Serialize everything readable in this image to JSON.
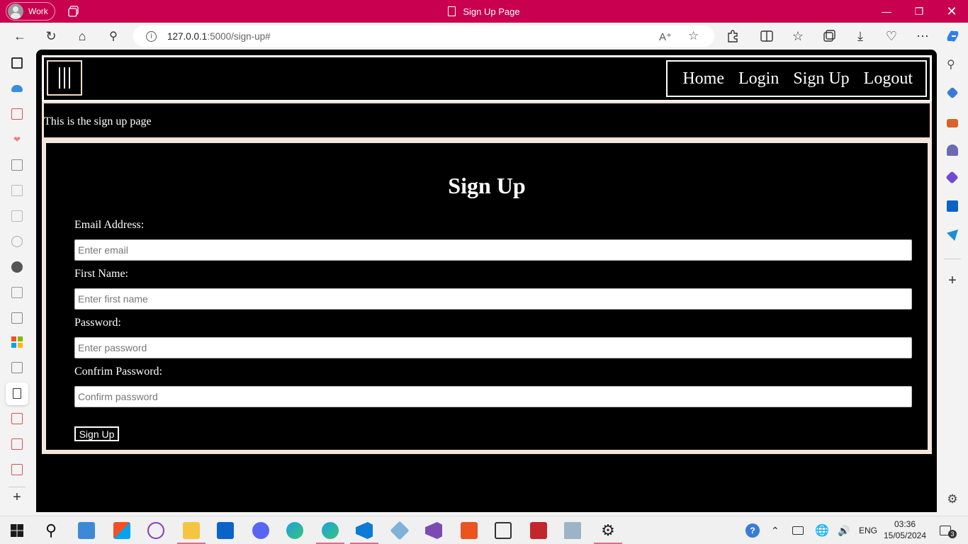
{
  "titlebar": {
    "profile_label": "Work",
    "window_title": "Sign Up Page"
  },
  "browser": {
    "url_host": "127.0.0.1",
    "url_rest": ":5000/sign-up#"
  },
  "site": {
    "nav": [
      "Home",
      "Login",
      "Sign Up",
      "Logout"
    ],
    "intro_text": "This is the sign up page",
    "form": {
      "title": "Sign Up",
      "fields": [
        {
          "label": "Email Address:",
          "placeholder": "Enter email"
        },
        {
          "label": "First Name:",
          "placeholder": "Enter first name"
        },
        {
          "label": "Password:",
          "placeholder": "Enter password"
        },
        {
          "label": "Confrim Password:",
          "placeholder": "Confirm password"
        }
      ],
      "submit_label": "Sign Up"
    }
  },
  "taskbar": {
    "language": "ENG",
    "time": "03:36",
    "date": "15/05/2024",
    "notification_count": "3"
  },
  "colors": {
    "titlebar": "#c8004f",
    "page_background": "#000000"
  }
}
